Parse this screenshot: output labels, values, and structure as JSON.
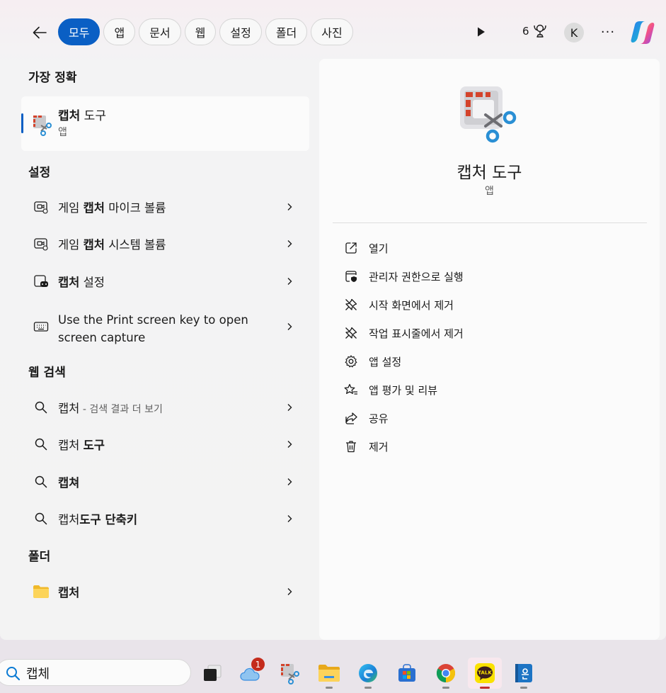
{
  "filters": {
    "tabs": [
      "모두",
      "앱",
      "문서",
      "웹",
      "설정",
      "폴더",
      "사진"
    ],
    "active_index": 0
  },
  "header": {
    "rewards_count": "6",
    "avatar_initial": "K",
    "more": "···"
  },
  "best_match": {
    "section": "가장 정확",
    "title_bold": "캡처",
    "title_rest": " 도구",
    "subtitle": "앱"
  },
  "settings": {
    "section": "설정",
    "items": [
      {
        "pre": "게임 ",
        "bold": "캡처",
        "post": " 마이크 볼륨"
      },
      {
        "pre": "게임 ",
        "bold": "캡처",
        "post": " 시스템 볼륨"
      },
      {
        "pre": "",
        "bold": "캡처",
        "post": " 설정"
      },
      {
        "line1": "Use the Print screen key to open",
        "line2": "screen capture"
      }
    ]
  },
  "web_search": {
    "section": "웹 검색",
    "items": [
      {
        "pre": "캡처",
        "bold": "",
        "sub": " - 검색 결과 더 보기"
      },
      {
        "pre": "캡처 ",
        "bold": "도구",
        "sub": ""
      },
      {
        "pre": "",
        "bold": "캡쳐",
        "sub": ""
      },
      {
        "pre": "캡처",
        "bold": "도구 단축키",
        "sub": ""
      }
    ]
  },
  "folders": {
    "section": "폴더",
    "items": [
      {
        "bold": "캡처"
      }
    ]
  },
  "detail": {
    "title": "캡처 도구",
    "subtitle": "앱",
    "actions": [
      "열기",
      "관리자 권한으로 실행",
      "시작 화면에서 제거",
      "작업 표시줄에서 제거",
      "앱 설정",
      "앱 평가 및 리뷰",
      "공유",
      "제거"
    ]
  },
  "taskbar": {
    "search_value": "캡체",
    "onedrive_badge": "1",
    "kakao_label": "TALK"
  },
  "colors": {
    "accent": "#0a5fc4",
    "snip_red": "#d4432b",
    "snip_blue": "#2a8fd4"
  }
}
